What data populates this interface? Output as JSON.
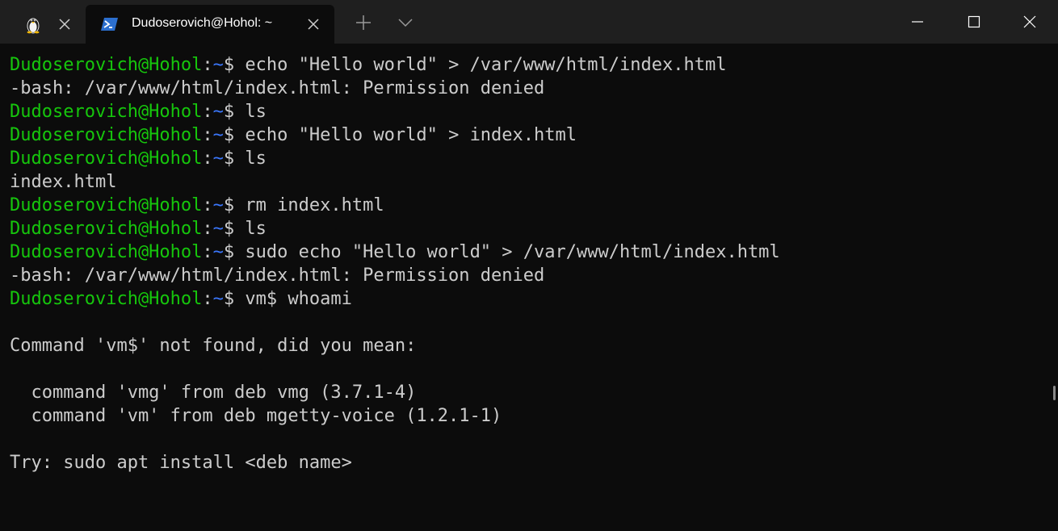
{
  "tabs": [
    {
      "title": "",
      "icon": "linux-penguin-icon",
      "active": false
    },
    {
      "title": "Dudoserovich@Hohol: ~",
      "icon": "powershell-icon",
      "active": true
    }
  ],
  "prompt": {
    "user": "Dudoserovich@Hohol",
    "sep": ":",
    "path": "~",
    "symbol": "$"
  },
  "lines": [
    {
      "type": "cmd",
      "text": " echo \"Hello world\" > /var/www/html/index.html"
    },
    {
      "type": "out",
      "text": "-bash: /var/www/html/index.html: Permission denied"
    },
    {
      "type": "cmd",
      "text": " ls"
    },
    {
      "type": "cmd",
      "text": " echo \"Hello world\" > index.html"
    },
    {
      "type": "cmd",
      "text": " ls"
    },
    {
      "type": "out",
      "text": "index.html"
    },
    {
      "type": "cmd",
      "text": " rm index.html"
    },
    {
      "type": "cmd",
      "text": " ls"
    },
    {
      "type": "cmd",
      "text": " sudo echo \"Hello world\" > /var/www/html/index.html"
    },
    {
      "type": "out",
      "text": "-bash: /var/www/html/index.html: Permission denied"
    },
    {
      "type": "cmd",
      "text": " vm$ whoami"
    },
    {
      "type": "out",
      "text": ""
    },
    {
      "type": "out",
      "text": "Command 'vm$' not found, did you mean:"
    },
    {
      "type": "out",
      "text": ""
    },
    {
      "type": "out",
      "text": "  command 'vmg' from deb vmg (3.7.1-4)"
    },
    {
      "type": "out",
      "text": "  command 'vm' from deb mgetty-voice (1.2.1-1)"
    },
    {
      "type": "out",
      "text": ""
    },
    {
      "type": "out",
      "text": "Try: sudo apt install <deb name>"
    }
  ],
  "colors": {
    "background": "#0c0c0c",
    "titlebar": "#1f1f1f",
    "prompt_user": "#16c60c",
    "prompt_path": "#3b78ff",
    "text": "#cccccc"
  }
}
